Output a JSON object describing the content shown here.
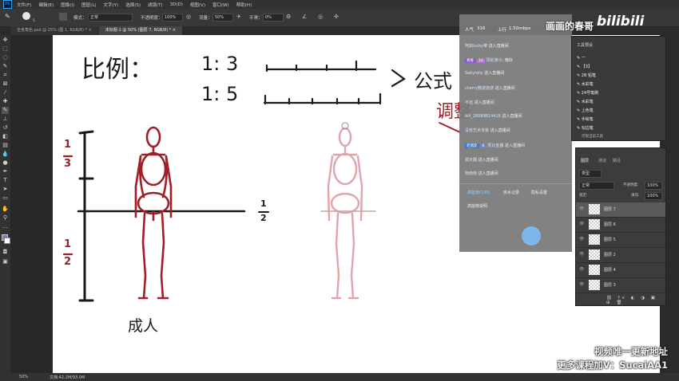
{
  "menu": [
    "文件(F)",
    "编辑(E)",
    "图像(I)",
    "图层(L)",
    "文字(Y)",
    "选择(S)",
    "滤镜(T)",
    "3D(D)",
    "视图(V)",
    "窗口(W)",
    "帮助(H)"
  ],
  "options": {
    "mode_label": "模式：",
    "mode_value": "正常",
    "opacity_label": "不透明度：",
    "opacity_value": "100%",
    "flow_label": "流量：",
    "flow_value": "50%",
    "smooth_label": "平滑：",
    "smooth_value": "0%",
    "brush_size": "5"
  },
  "tabs": [
    "全身角色.psd @ 25% (图 1, RGB/8) *",
    "未标题-1 @ 50% (图层 7, RGB/8) *"
  ],
  "status": {
    "zoom": "50%",
    "doc": "文档:42.2M/93.0M"
  },
  "chat": {
    "popularity_label": "人气",
    "popularity": "316",
    "upload_label": "上行",
    "upload": "1.50mbps",
    "rows": [
      {
        "name": "阿如lucky樂",
        "msg": "进入直播间"
      },
      {
        "badge": "青春",
        "level": "10",
        "name": "阳处演子:",
        "msg": "晚好"
      },
      {
        "name": "Sakyrelly",
        "msg": "进入直播间"
      },
      {
        "name": "cherry微波逸感",
        "msg": "进入直播间"
      },
      {
        "name": "不远",
        "msg": "进入直播间"
      },
      {
        "name": "bili_28089814416",
        "msg": "进入直播间"
      },
      {
        "name": "没有艺术背景",
        "msg": "进入直播间"
      },
      {
        "badge": "老朋友",
        "level": "6",
        "name": "粥比金器",
        "msg": "进入直播间"
      },
      {
        "name": "狐天翻",
        "msg": "进入直播间"
      },
      {
        "name": "随南南",
        "msg": "进入直播间"
      }
    ],
    "tab_1": "高能榜(130)",
    "tab_2": "房水记录",
    "tab_3": "隐私设置",
    "footer": "高能榜说明"
  },
  "brush_panel": {
    "title": "工具预设",
    "items": [
      "一",
      "【3】",
      "2B 铅笔",
      "水彩笔",
      "24号笔刷",
      "水彩笔",
      "上色笔",
      "手绘笔",
      "勾边笔"
    ],
    "footer": "仅限当前工具"
  },
  "layers": {
    "tabs": [
      "图层",
      "通道",
      "路径"
    ],
    "kind": "类型",
    "blend": "正常",
    "opacity_label": "不透明度:",
    "opacity": "100%",
    "lock_label": "锁定:",
    "fill_label": "填充:",
    "fill": "100%",
    "items": [
      "图层 7",
      "图层 6",
      "图层 5",
      "图层 2",
      "图层 4",
      "图层 3"
    ],
    "selected": 0
  },
  "canvas_text": {
    "ratio_title": "比例：",
    "ratio_1": "1: 3",
    "ratio_2": "1: 5",
    "formula": "公式",
    "tune": "调整",
    "third_num": "1",
    "third_den": "3",
    "half_num": "1",
    "half_den": "2",
    "half_right_num": "1",
    "half_right_den": "2",
    "adult": "成人"
  },
  "watermark": {
    "brand": "画画的春哥",
    "bili": "bilibili",
    "line1": "视频唯一更新地址",
    "line2": "更多课程加V：SucaiAA1"
  },
  "colors": {
    "red": "#a01e28",
    "pink": "#e3a3aa",
    "black": "#1a1a1a",
    "canvas": "#ffffff"
  }
}
